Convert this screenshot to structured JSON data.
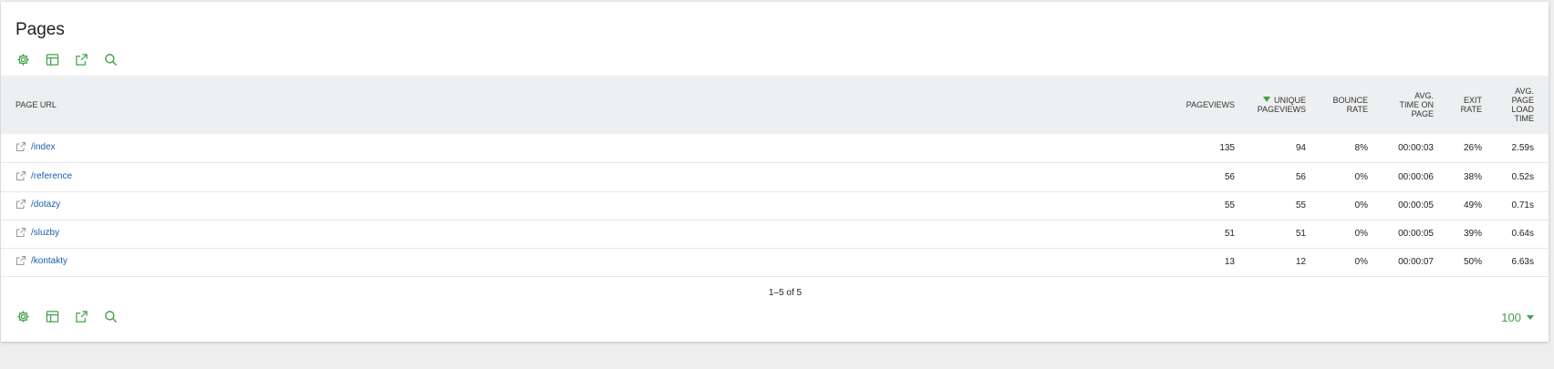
{
  "report": {
    "title": "Pages"
  },
  "icons": [
    "gear-icon",
    "table-icon",
    "export-icon",
    "search-icon"
  ],
  "table": {
    "columns": [
      {
        "key": "page_url",
        "label": "PAGE URL"
      },
      {
        "key": "pageviews",
        "label": "PAGEVIEWS"
      },
      {
        "key": "unique_pageviews",
        "label": "UNIQUE PAGEVIEWS",
        "sorted": "desc"
      },
      {
        "key": "bounce_rate",
        "label": "BOUNCE RATE"
      },
      {
        "key": "avg_time",
        "label": "AVG. TIME ON PAGE"
      },
      {
        "key": "exit_rate",
        "label": "EXIT RATE"
      },
      {
        "key": "avg_load",
        "label": "AVG. PAGE LOAD TIME"
      }
    ],
    "header_lines": {
      "page_url": [
        "PAGE URL"
      ],
      "pageviews": [
        "PAGEVIEWS"
      ],
      "unique_pageviews": [
        "UNIQUE",
        "PAGEVIEWS"
      ],
      "bounce_rate": [
        "BOUNCE",
        "RATE"
      ],
      "avg_time": [
        "AVG.",
        "TIME ON",
        "PAGE"
      ],
      "exit_rate": [
        "EXIT",
        "RATE"
      ],
      "avg_load": [
        "AVG.",
        "PAGE",
        "LOAD",
        "TIME"
      ]
    },
    "rows": [
      {
        "url": "/index",
        "pageviews": "135",
        "unique_pageviews": "94",
        "bounce_rate": "8%",
        "avg_time": "00:00:03",
        "exit_rate": "26%",
        "avg_load": "2.59s"
      },
      {
        "url": "/reference",
        "pageviews": "56",
        "unique_pageviews": "56",
        "bounce_rate": "0%",
        "avg_time": "00:00:06",
        "exit_rate": "38%",
        "avg_load": "0.52s"
      },
      {
        "url": "/dotazy",
        "pageviews": "55",
        "unique_pageviews": "55",
        "bounce_rate": "0%",
        "avg_time": "00:00:05",
        "exit_rate": "49%",
        "avg_load": "0.71s"
      },
      {
        "url": "/sluzby",
        "pageviews": "51",
        "unique_pageviews": "51",
        "bounce_rate": "0%",
        "avg_time": "00:00:05",
        "exit_rate": "39%",
        "avg_load": "0.64s"
      },
      {
        "url": "/kontakty",
        "pageviews": "13",
        "unique_pageviews": "12",
        "bounce_rate": "0%",
        "avg_time": "00:00:07",
        "exit_rate": "50%",
        "avg_load": "6.63s"
      }
    ]
  },
  "pagination": {
    "info": "1–5 of 5",
    "limit": "100"
  },
  "colors": {
    "accent": "#43a047",
    "link": "#1a5fa8",
    "header_bg": "#eeeff0"
  }
}
